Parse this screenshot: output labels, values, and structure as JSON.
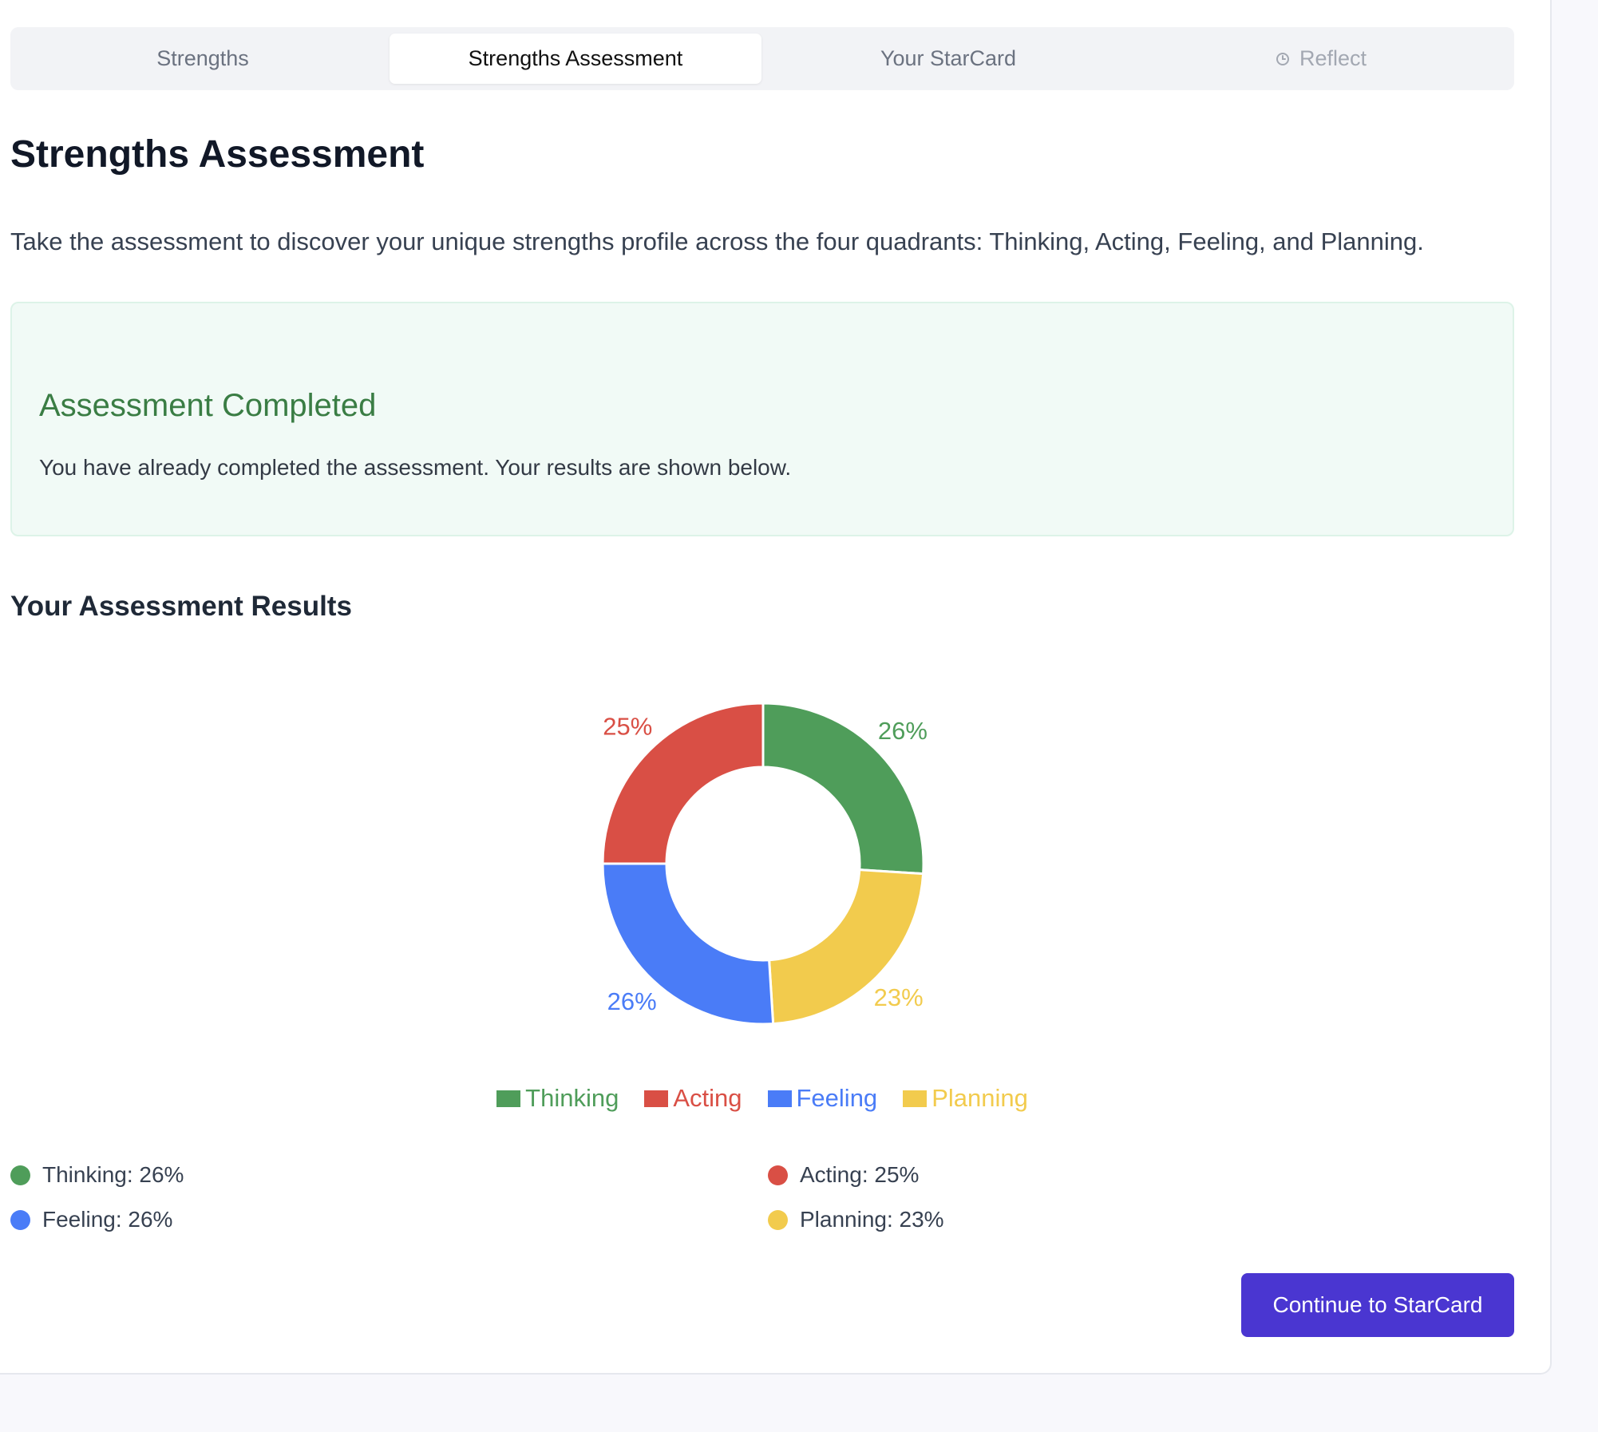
{
  "tabs": [
    {
      "label": "Strengths",
      "state": "inactive"
    },
    {
      "label": "Strengths Assessment",
      "state": "active"
    },
    {
      "label": "Your StarCard",
      "state": "inactive"
    },
    {
      "label": "Reflect",
      "state": "disabled",
      "icon": "clock-icon"
    }
  ],
  "page": {
    "title": "Strengths Assessment",
    "intro": "Take the assessment to discover your unique strengths profile across the four quadrants: Thinking, Acting, Feeling, and Planning."
  },
  "notice": {
    "title": "Assessment Completed",
    "text": "You have already completed the assessment. Your results are shown below."
  },
  "results": {
    "title": "Your Assessment Results",
    "summary": [
      {
        "text": "Thinking: 26%",
        "color": "#4f9d5a"
      },
      {
        "text": "Acting: 25%",
        "color": "#d94f45"
      },
      {
        "text": "Feeling: 26%",
        "color": "#4a7cf7"
      },
      {
        "text": "Planning: 23%",
        "color": "#f2cb4d"
      }
    ]
  },
  "chart_data": {
    "type": "pie",
    "variant": "donut",
    "categories": [
      "Thinking",
      "Planning",
      "Feeling",
      "Acting"
    ],
    "values": [
      26,
      23,
      26,
      25
    ],
    "labels": [
      "26%",
      "23%",
      "26%",
      "25%"
    ],
    "colors": [
      "#4f9d5a",
      "#f2cb4d",
      "#4a7cf7",
      "#d94f45"
    ],
    "legend": {
      "position": "bottom",
      "entries": [
        {
          "label": "Thinking",
          "color": "#4f9d5a"
        },
        {
          "label": "Acting",
          "color": "#d94f45"
        },
        {
          "label": "Feeling",
          "color": "#4a7cf7"
        },
        {
          "label": "Planning",
          "color": "#f2cb4d"
        }
      ]
    }
  },
  "actions": {
    "continue_label": "Continue to StarCard"
  }
}
